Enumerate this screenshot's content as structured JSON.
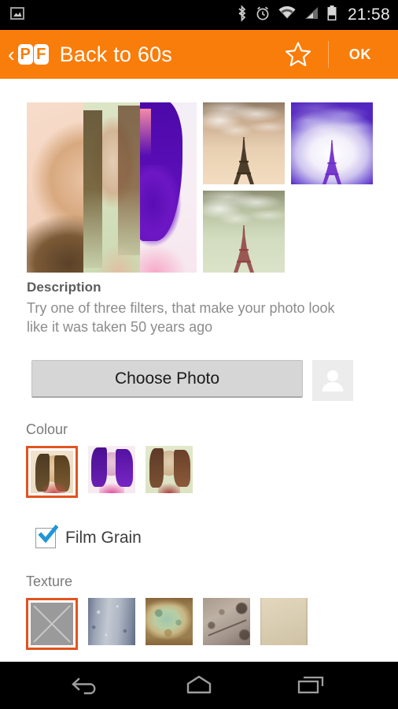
{
  "status_bar": {
    "time": "21:58",
    "icons": [
      "gallery-image-icon",
      "bluetooth-icon",
      "alarm-clock-icon",
      "wifi-icon",
      "cellular-signal-icon",
      "battery-icon"
    ],
    "background": "#000000"
  },
  "app_bar": {
    "back_label": "‹",
    "logo_text_1": "P",
    "logo_text_2": "F",
    "title": "Back to 60s",
    "favorite_icon": "star-outline-icon",
    "confirm_label": "OK",
    "background": "#f97d0a"
  },
  "gallery": {
    "hero_alt": "portrait-filter-preview",
    "hero_bands": [
      "sepia-peach",
      "green-tint",
      "purple-tint"
    ],
    "thumbnails": [
      {
        "name": "eiffel-sepia",
        "tint": "#d9b38c"
      },
      {
        "name": "eiffel-purple",
        "tint": "#6a3cc4"
      },
      {
        "name": "eiffel-green",
        "tint": "#b9cbab"
      }
    ]
  },
  "description": {
    "heading": "Description",
    "body": "Try one of three filters, that make your photo look like it was taken 50 years ago"
  },
  "choose_photo": {
    "label": "Choose Photo",
    "avatar_icon": "person-placeholder-icon"
  },
  "colour": {
    "label": "Colour",
    "options": [
      {
        "name": "colour-sepia",
        "selected": true
      },
      {
        "name": "colour-purple",
        "selected": false
      },
      {
        "name": "colour-green",
        "selected": false
      }
    ],
    "selected_index": 0,
    "selection_color": "#e2531f"
  },
  "film_grain": {
    "label": "Film Grain",
    "checked": true,
    "check_color": "#2196d6"
  },
  "texture": {
    "label": "Texture",
    "options": [
      {
        "name": "texture-none",
        "selected": true
      },
      {
        "name": "texture-blue-grunge",
        "selected": false
      },
      {
        "name": "texture-green-mottled",
        "selected": false
      },
      {
        "name": "texture-brown-cracked",
        "selected": false
      },
      {
        "name": "texture-cream-paper",
        "selected": false
      }
    ],
    "selected_index": 0,
    "selection_color": "#e2531f"
  },
  "nav_bar": {
    "buttons": [
      "back-nav-icon",
      "home-nav-icon",
      "recents-nav-icon"
    ],
    "background": "#000000"
  }
}
